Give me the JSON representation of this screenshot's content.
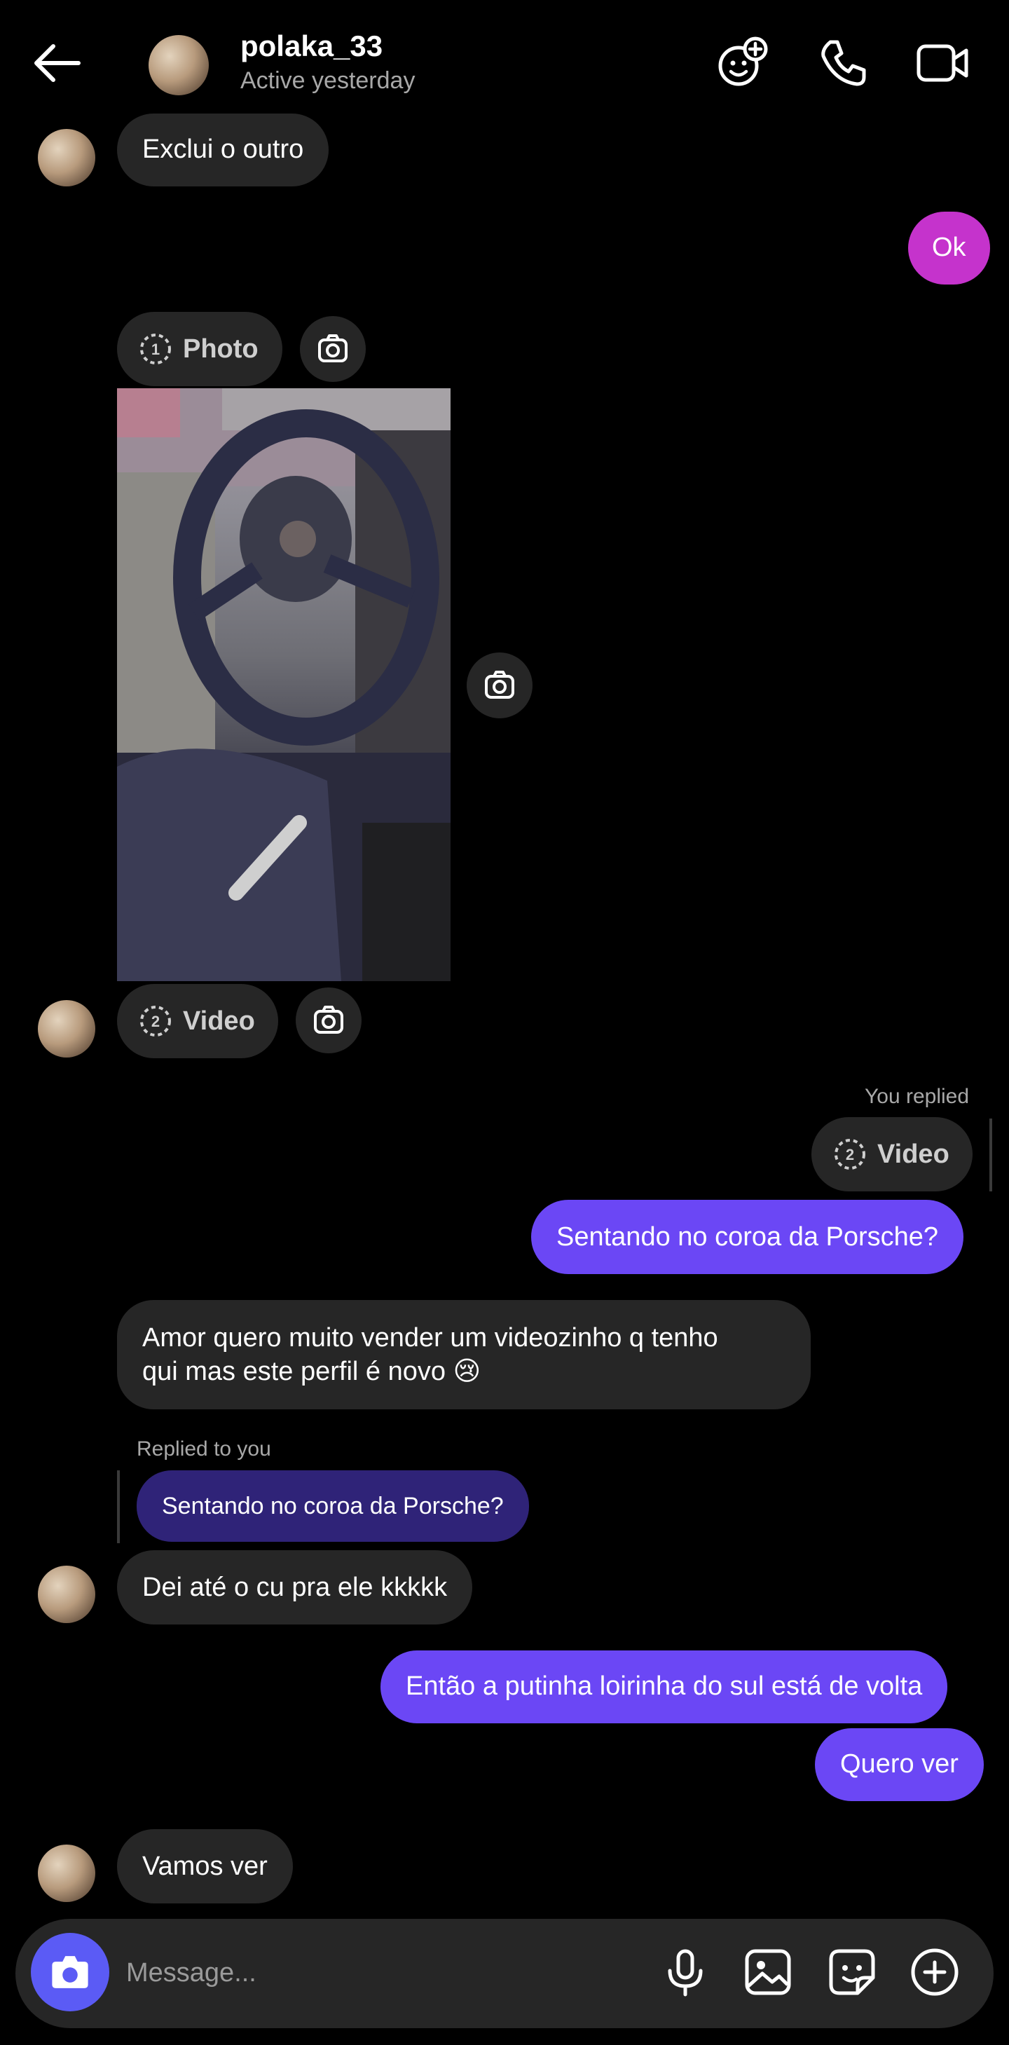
{
  "header": {
    "username": "polaka_33",
    "presence": "Active yesterday",
    "icons": [
      "back-arrow-icon",
      "add-effect-icon",
      "phone-icon",
      "video-camera-icon"
    ]
  },
  "messages": {
    "m1": "Exclui o outro",
    "m2": "Ok",
    "photo_label": "Photo",
    "photo_index": "1",
    "video_label": "Video",
    "video_index": "2",
    "you_replied": "You replied",
    "reply_video_label": "Video",
    "reply_video_index": "2",
    "m3": "Sentando no coroa da Porsche?",
    "m4_line1": "Amor quero muito vender um videozinho q tenho",
    "m4_line2": "qui mas este perfil é novo 😢",
    "replied_to_you": "Replied to you",
    "quoted": "Sentando no coroa da Porsche?",
    "m5": "Dei até o cu pra ele kkkkk",
    "m6": "Então a putinha loirinha do sul está de volta",
    "m7": "Quero ver",
    "m8": "Vamos ver"
  },
  "composer": {
    "placeholder": "Message...",
    "icons": [
      "camera-icon",
      "microphone-icon",
      "gallery-icon",
      "sticker-icon",
      "plus-icon"
    ]
  },
  "colors": {
    "background": "#000000",
    "incoming_bubble": "#262626",
    "outgoing_bubble": "#6b47f5",
    "outgoing_magenta": "#c533cc",
    "camera_button": "#5b5bf5"
  }
}
